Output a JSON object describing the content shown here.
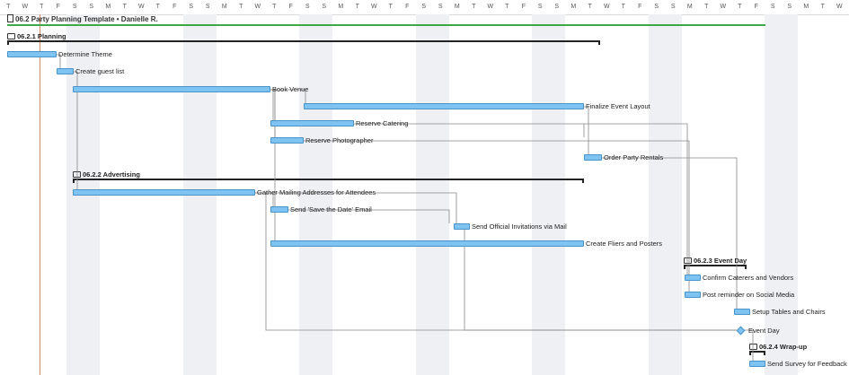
{
  "header": {
    "days": [
      "T",
      "W",
      "T",
      "F",
      "S",
      "S",
      "M",
      "T",
      "W",
      "T",
      "F",
      "S",
      "S",
      "M",
      "T",
      "W",
      "T",
      "F",
      "S",
      "S",
      "M",
      "T",
      "W",
      "T",
      "F",
      "S",
      "S",
      "M",
      "T",
      "W",
      "T",
      "F",
      "S",
      "S",
      "M",
      "T",
      "W",
      "T",
      "F",
      "S",
      "S",
      "M",
      "T",
      "W",
      "T",
      "F",
      "S",
      "S",
      "M",
      "T",
      "W"
    ]
  },
  "project": {
    "title": "06.2 Party Planning Template • Danielle R.",
    "icon": "document-icon",
    "accent": "#3ea84a"
  },
  "groups": [
    {
      "id": "planning",
      "label": "06.2.1 Planning"
    },
    {
      "id": "advertising",
      "label": "06.2.2 Advertising"
    },
    {
      "id": "event-day",
      "label": "06.2.3 Event Day"
    },
    {
      "id": "wrap-up",
      "label": "06.2.4 Wrap-up"
    }
  ],
  "tasks": [
    {
      "id": "t1",
      "label": "Determine Theme"
    },
    {
      "id": "t2",
      "label": "Create guest list"
    },
    {
      "id": "t3",
      "label": "Book Venue"
    },
    {
      "id": "t4",
      "label": "Finalize Event Layout"
    },
    {
      "id": "t5",
      "label": "Reserve Catering"
    },
    {
      "id": "t6",
      "label": "Reserve Photographer"
    },
    {
      "id": "t7",
      "label": "Order Party Rentals"
    },
    {
      "id": "t8",
      "label": "Gather Mailing Addresses for Attendees"
    },
    {
      "id": "t9",
      "label": "Send 'Save the Date' Email"
    },
    {
      "id": "t10",
      "label": "Send Official Invitations via Mail"
    },
    {
      "id": "t11",
      "label": "Create Fliers and Posters"
    },
    {
      "id": "t12",
      "label": "Confirm Caterers and Vendors"
    },
    {
      "id": "t13",
      "label": "Post reminder on Social Media"
    },
    {
      "id": "t14",
      "label": "Setup Tables and Chairs"
    },
    {
      "id": "t15",
      "label": "Event Day"
    },
    {
      "id": "t16",
      "label": "Send Survey for Feedback"
    }
  ],
  "colors": {
    "bar_fill": "#7fc3f2",
    "bar_border": "#4a93c8",
    "weekend": "#eef0f4",
    "today": "#d18a6a"
  }
}
